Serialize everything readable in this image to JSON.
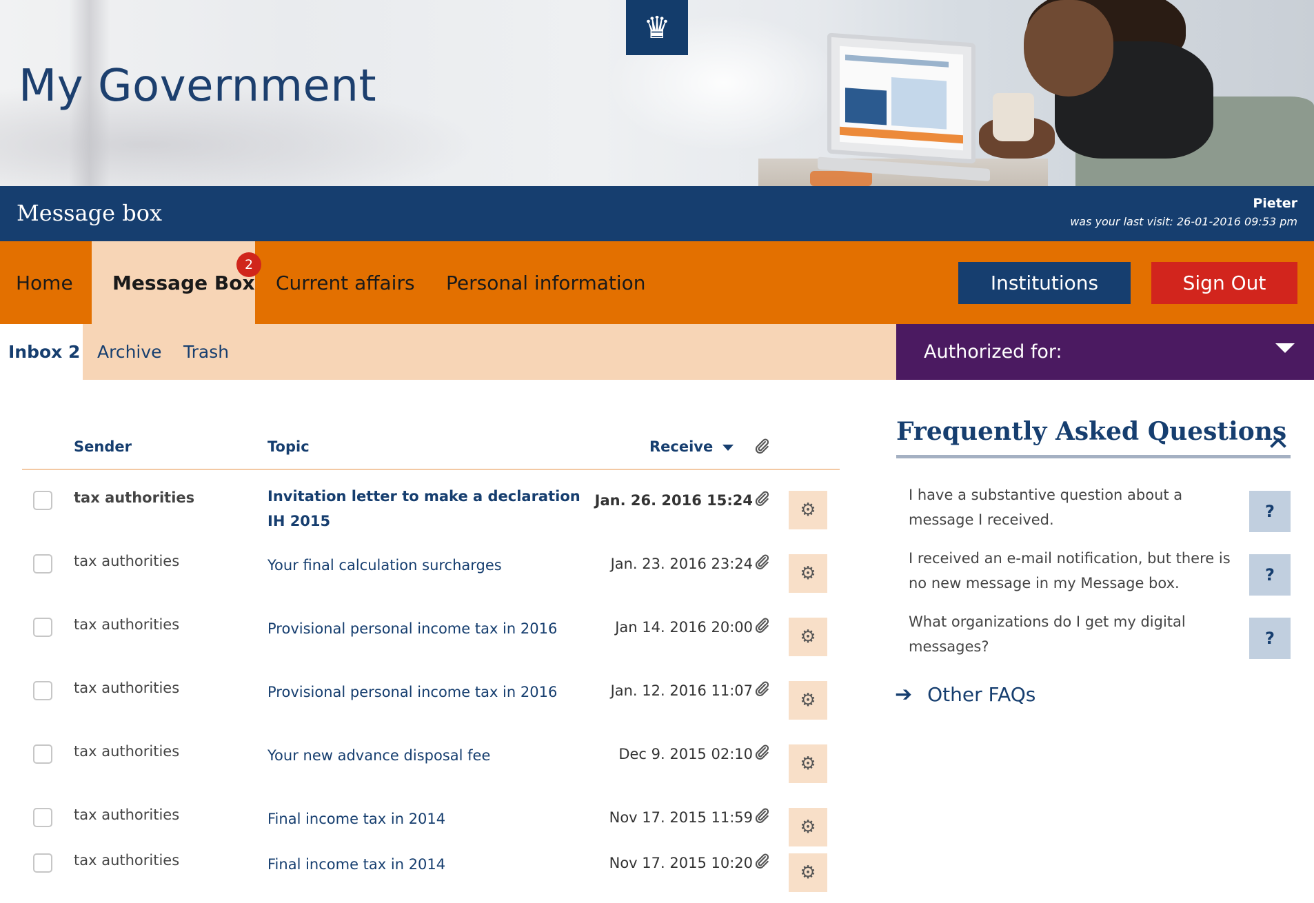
{
  "hero": {
    "title": "My Government",
    "crest_icon": "♛"
  },
  "header": {
    "title": "Message box",
    "user_name": "Pieter",
    "last_visit": "was your last visit: 26-01-2016 09:53 pm"
  },
  "nav": {
    "home": "Home",
    "message_box": "Message Box",
    "message_box_badge": "2",
    "current_affairs": "Current affairs",
    "personal_information": "Personal information",
    "institutions": "Institutions",
    "sign_out": "Sign Out"
  },
  "subnav": {
    "inbox": "Inbox 2",
    "archive": "Archive",
    "trash": "Trash",
    "authorized_for": "Authorized for:"
  },
  "table": {
    "headers": {
      "sender": "Sender",
      "topic": "Topic",
      "receive": "Receive"
    },
    "rows": [
      {
        "sender": "tax authorities",
        "topic": "Invitation letter to make a declaration IH 2015",
        "date": "Jan. 26. 2016 15:24",
        "unread": true
      },
      {
        "sender": "tax authorities",
        "topic": "Your final calculation surcharges",
        "date": "Jan. 23. 2016 23:24",
        "unread": false
      },
      {
        "sender": "tax authorities",
        "topic": "Provisional personal income tax in 2016",
        "date": "Jan 14. 2016 20:00",
        "unread": false
      },
      {
        "sender": "tax authorities",
        "topic": "Provisional personal income tax in 2016",
        "date": "Jan. 12. 2016 11:07",
        "unread": false
      },
      {
        "sender": "tax authorities",
        "topic": "Your new advance disposal fee",
        "date": "Dec 9. 2015 02:10",
        "unread": false
      },
      {
        "sender": "tax authorities",
        "topic": "Final income tax in 2014",
        "date": "Nov 17. 2015 11:59",
        "unread": false
      },
      {
        "sender": "tax authorities",
        "topic": "Final income tax in 2014",
        "date": "Nov 17. 2015 10:20",
        "unread": false
      }
    ]
  },
  "faq": {
    "title": "Frequently Asked Questions",
    "items": [
      {
        "question": "I have a substantive question about a message I received.",
        "button": "?"
      },
      {
        "question": "I received an e-mail notification, but there is no new message in my Message box.",
        "button": "?"
      },
      {
        "question": "What organizations do I get my digital messages?",
        "button": "?"
      }
    ],
    "other": "Other FAQs",
    "other_icon": "➔"
  },
  "colors": {
    "brand_blue": "#163e6f",
    "nav_orange": "#e37000",
    "subnav_peach": "#f7d5b6",
    "authorized_purple": "#4b1a61",
    "sign_out_red": "#d2251d",
    "badge_red": "#d0251b"
  }
}
